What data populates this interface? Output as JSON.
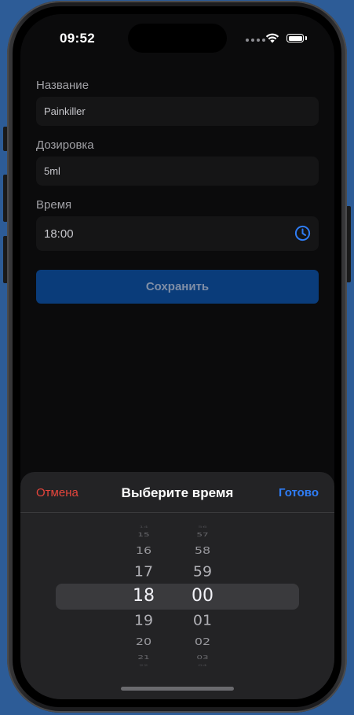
{
  "status_bar": {
    "time": "09:52"
  },
  "form": {
    "name_label": "Название",
    "name_value": "Painkiller",
    "dosage_label": "Дозировка",
    "dosage_value": "5ml",
    "time_label": "Время",
    "time_value": "18:00",
    "save_label": "Сохранить"
  },
  "sheet": {
    "cancel_label": "Отмена",
    "title": "Выберите время",
    "done_label": "Готово"
  },
  "picker": {
    "hours": [
      "14",
      "15",
      "16",
      "17",
      "18",
      "19",
      "20",
      "21",
      "22"
    ],
    "minutes": [
      "56",
      "57",
      "58",
      "59",
      "00",
      "01",
      "02",
      "03",
      "04"
    ],
    "selected_hour": "18",
    "selected_minute": "00"
  },
  "colors": {
    "accent": "#2f7df6",
    "cancel": "#e5453c",
    "save_button": "#0a3c7a",
    "background": "#0b0b0c"
  },
  "icons": {
    "clock": "clock-icon",
    "wifi": "wifi-icon",
    "battery": "battery-icon"
  }
}
